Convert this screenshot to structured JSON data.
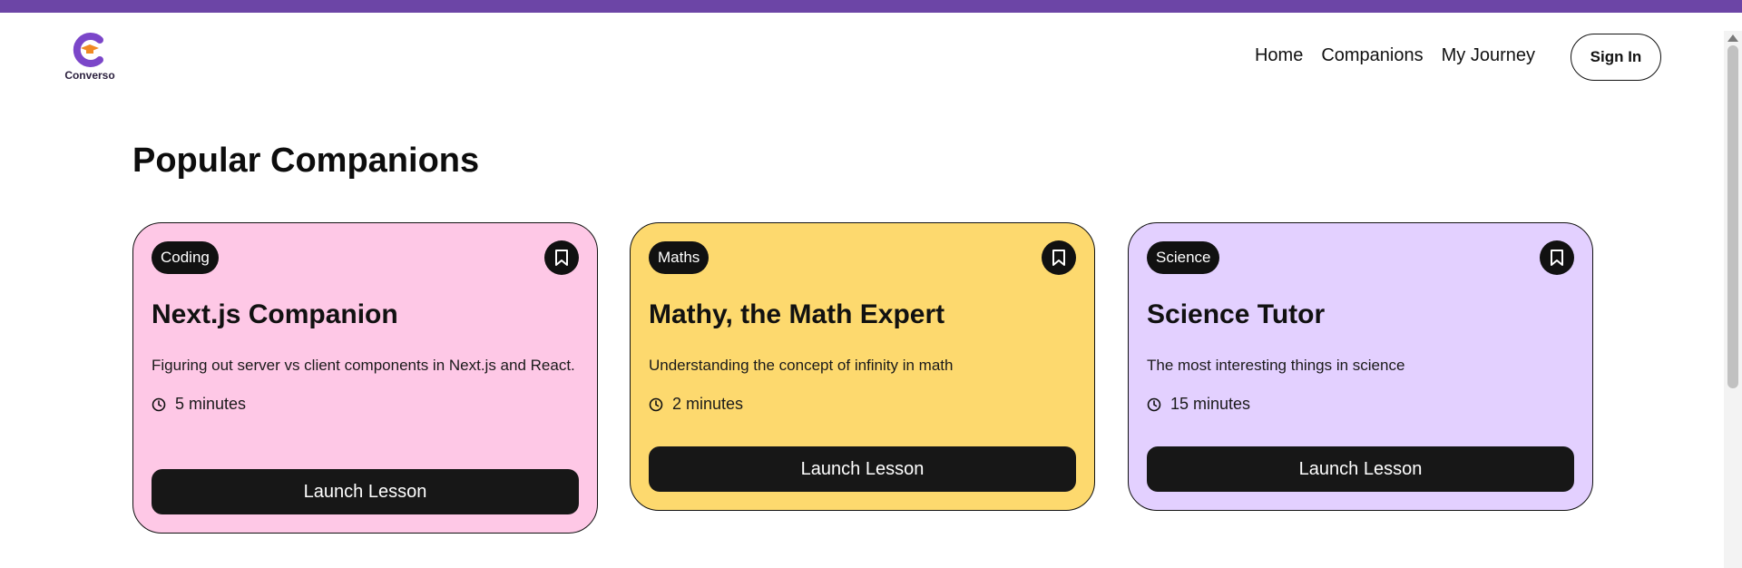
{
  "app": {
    "logo_text": "Converso",
    "brand_color": "#6c45a6"
  },
  "nav": {
    "items": [
      {
        "label": "Home"
      },
      {
        "label": "Companions"
      },
      {
        "label": "My Journey"
      }
    ],
    "signin_label": "Sign In"
  },
  "main": {
    "section_title": "Popular Companions",
    "cards": [
      {
        "subject": "Coding",
        "name": "Next.js Companion",
        "topic": "Figuring out server vs client components in Next.js and React.",
        "duration": "5 minutes",
        "cta": "Launch Lesson",
        "color": "#fec8e6"
      },
      {
        "subject": "Maths",
        "name": "Mathy, the Math Expert",
        "topic": "Understanding the concept of infinity in math",
        "duration": "2 minutes",
        "cta": "Launch Lesson",
        "color": "#fdd96e"
      },
      {
        "subject": "Science",
        "name": "Science Tutor",
        "topic": "The most interesting things in science",
        "duration": "15 minutes",
        "cta": "Launch Lesson",
        "color": "#e3d0ff"
      }
    ]
  }
}
